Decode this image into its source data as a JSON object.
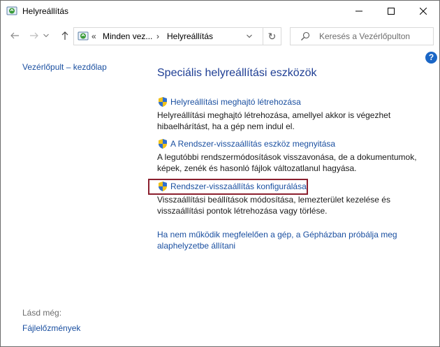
{
  "window": {
    "title": "Helyreállítás",
    "icon": "recovery-app-icon"
  },
  "titlebar_buttons": {
    "minimize_icon": "minimize-icon",
    "maximize_icon": "maximize-icon",
    "close_icon": "close-icon"
  },
  "address": {
    "chevron": "«",
    "crumb1": "Minden vez...",
    "separator": "›",
    "crumb2": "Helyreállítás",
    "refresh_glyph": "↻"
  },
  "search": {
    "placeholder": "Keresés a Vezérlőpulton"
  },
  "help": {
    "label": "?"
  },
  "left_pane": {
    "home_link": "Vezérlőpult – kezdőlap",
    "see_also": "Lásd még:",
    "file_history": "Fájlelőzmények"
  },
  "main": {
    "title": "Speciális helyreállítási eszközök",
    "items": [
      {
        "link": "Helyreállítási meghajtó létrehozása",
        "desc": "Helyreállítási meghajtó létrehozása, amellyel akkor is végezhet hibaelhárítást, ha a gép nem indul el."
      },
      {
        "link": "A Rendszer-visszaállítás eszköz megnyitása",
        "desc": "A legutóbbi rendszermódosítások visszavonása, de a dokumentumok, képek, zenék és hasonló fájlok változatlanul hagyása."
      },
      {
        "link": "Rendszer-visszaállítás konfigurálása",
        "desc": "Visszaállítási beállítások módosítása, lemezterület kezelése és visszaállítási pontok létrehozása vagy törlése."
      }
    ],
    "bottom_link": "Ha nem működik megfelelően a gép, a Gépházban próbálja meg alaphelyzetbe állítani"
  },
  "colors": {
    "link": "#1a4fa0",
    "title": "#1e3e94",
    "highlight_border": "#8b1f2e",
    "help_badge": "#1a66c6"
  }
}
